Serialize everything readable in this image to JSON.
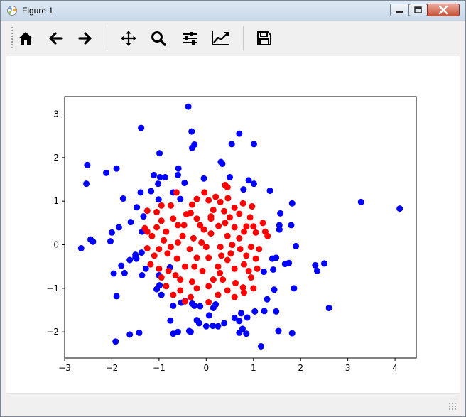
{
  "window": {
    "title": "Figure 1",
    "icons": {
      "app": "matplotlib-app-icon",
      "minimize": "minimize-icon",
      "maximize": "maximize-icon",
      "close": "close-icon"
    }
  },
  "toolbar": {
    "buttons": [
      {
        "name": "home",
        "icon": "home-icon"
      },
      {
        "name": "back",
        "icon": "arrow-left-icon"
      },
      {
        "name": "forward",
        "icon": "arrow-right-icon"
      },
      {
        "name": "pan",
        "icon": "move-icon"
      },
      {
        "name": "zoom",
        "icon": "zoom-icon"
      },
      {
        "name": "subplots",
        "icon": "sliders-icon"
      },
      {
        "name": "edit-axes",
        "icon": "line-chart-icon"
      },
      {
        "name": "save",
        "icon": "save-icon"
      }
    ]
  },
  "colors": {
    "class_outer": "#0000ff",
    "class_inner": "#ff0000"
  },
  "chart_data": {
    "type": "scatter",
    "title": "",
    "xlabel": "",
    "ylabel": "",
    "xlim": [
      -3,
      4.45
    ],
    "ylim": [
      -2.6,
      3.4
    ],
    "x_ticks": [
      -3,
      -2,
      -1,
      0,
      1,
      2,
      3,
      4
    ],
    "y_ticks": [
      -2,
      -1,
      0,
      1,
      2,
      3
    ],
    "x_tick_labels": [
      "−3",
      "−2",
      "−1",
      "0",
      "1",
      "2",
      "3",
      "4"
    ],
    "y_tick_labels": [
      "−2",
      "−1",
      "0",
      "1",
      "2",
      "3"
    ],
    "grid": false,
    "legend": "none",
    "series": [
      {
        "color": "#0000ff",
        "points": [
          [
            -0.38,
            3.17
          ],
          [
            -0.31,
            2.6
          ],
          [
            0.7,
            2.55
          ],
          [
            -1.38,
            2.68
          ],
          [
            -0.3,
            2.22
          ],
          [
            -0.25,
            2.3
          ],
          [
            0.54,
            2.31
          ],
          [
            1.01,
            2.31
          ],
          [
            -0.99,
            2.1
          ],
          [
            0.34,
            1.86
          ],
          [
            0.31,
            1.9
          ],
          [
            -2.52,
            1.83
          ],
          [
            -1.9,
            1.75
          ],
          [
            -2.12,
            1.65
          ],
          [
            -1.11,
            1.6
          ],
          [
            -0.98,
            1.55
          ],
          [
            -0.87,
            1.55
          ],
          [
            -0.59,
            1.75
          ],
          [
            -0.6,
            1.6
          ],
          [
            0.5,
            1.55
          ],
          [
            1.01,
            1.4
          ],
          [
            0.9,
            1.48
          ],
          [
            -0.05,
            1.52
          ],
          [
            -2.54,
            1.4
          ],
          [
            -1.02,
            1.4
          ],
          [
            -0.46,
            1.42
          ],
          [
            0.79,
            1.27
          ],
          [
            1.35,
            1.24
          ],
          [
            -1.17,
            1.23
          ],
          [
            -1.39,
            1.2
          ],
          [
            -0.7,
            1.2
          ],
          [
            -1.76,
            1.06
          ],
          [
            -1.01,
            1.04
          ],
          [
            -0.55,
            1.05
          ],
          [
            1.82,
            0.95
          ],
          [
            1.57,
            0.72
          ],
          [
            -1.47,
            0.86
          ],
          [
            -1.33,
            0.65
          ],
          [
            -1.6,
            0.52
          ],
          [
            -1.85,
            0.4
          ],
          [
            1.55,
            0.45
          ],
          [
            1.8,
            0.45
          ],
          [
            1.55,
            0.35
          ],
          [
            -2.0,
            0.28
          ],
          [
            -2.45,
            0.12
          ],
          [
            -2.4,
            0.07
          ],
          [
            -2.03,
            0.08
          ],
          [
            -1.36,
            0.3
          ],
          [
            -1.37,
            -0.18
          ],
          [
            1.9,
            -0.03
          ],
          [
            -1.5,
            -0.29
          ],
          [
            -1.48,
            -0.32
          ],
          [
            -1.5,
            -0.23
          ],
          [
            -2.65,
            -0.08
          ],
          [
            -1.62,
            -0.35
          ],
          [
            1.4,
            -0.32
          ],
          [
            1.48,
            -0.3
          ],
          [
            -1.8,
            -0.48
          ],
          [
            -1.28,
            -0.55
          ],
          [
            1.67,
            -0.44
          ],
          [
            1.75,
            -0.42
          ],
          [
            2.31,
            -0.47
          ],
          [
            2.5,
            -0.43
          ],
          [
            -1.73,
            -0.65
          ],
          [
            -1.96,
            -0.66
          ],
          [
            2.35,
            -0.6
          ],
          [
            -1.36,
            -0.7
          ],
          [
            1.42,
            -0.57
          ],
          [
            -1.0,
            -0.7
          ],
          [
            -0.77,
            -0.52
          ],
          [
            1.22,
            -0.62
          ],
          [
            -0.99,
            -0.93
          ],
          [
            -1.05,
            -1.02
          ],
          [
            -0.95,
            -1.15
          ],
          [
            -0.53,
            -1.33
          ],
          [
            -1.9,
            -1.18
          ],
          [
            -0.45,
            -1.29
          ],
          [
            -0.3,
            -1.35
          ],
          [
            0.2,
            -1.37
          ],
          [
            1.29,
            -1.25
          ],
          [
            1.86,
            -1.0
          ],
          [
            1.44,
            -1.03
          ],
          [
            -0.7,
            -1.4
          ],
          [
            -0.25,
            -1.4
          ],
          [
            -0.13,
            -1.41
          ],
          [
            2.6,
            -1.45
          ],
          [
            0.15,
            -1.45
          ],
          [
            0.74,
            -1.57
          ],
          [
            0.6,
            -1.68
          ],
          [
            0.06,
            -1.62
          ],
          [
            -0.76,
            -1.74
          ],
          [
            -0.2,
            -1.73
          ],
          [
            -0.15,
            -1.8
          ],
          [
            0.38,
            -1.8
          ],
          [
            0.7,
            -1.75
          ],
          [
            1.03,
            -1.53
          ],
          [
            1.23,
            -1.52
          ],
          [
            1.48,
            -1.53
          ],
          [
            0.87,
            -1.67
          ],
          [
            0.77,
            -1.93
          ],
          [
            0.0,
            -1.87
          ],
          [
            0.14,
            -1.86
          ],
          [
            -0.6,
            -2.0
          ],
          [
            -0.7,
            -2.04
          ],
          [
            -0.33,
            -2.0
          ],
          [
            -1.42,
            -2.02
          ],
          [
            -1.62,
            -2.06
          ],
          [
            -0.36,
            -1.98
          ],
          [
            0.25,
            -1.87
          ],
          [
            0.7,
            -2.02
          ],
          [
            0.85,
            -2.04
          ],
          [
            1.53,
            -1.98
          ],
          [
            1.82,
            -2.03
          ],
          [
            -1.92,
            -2.22
          ],
          [
            1.16,
            -2.33
          ],
          [
            3.28,
            0.98
          ],
          [
            4.1,
            0.83
          ]
        ]
      },
      {
        "color": "#ff0000",
        "points": [
          [
            0.4,
            1.37
          ],
          [
            0.45,
            1.32
          ],
          [
            -0.63,
            1.2
          ],
          [
            -0.04,
            1.2
          ],
          [
            -0.2,
            1.05
          ],
          [
            0.05,
            1.02
          ],
          [
            -0.95,
            0.9
          ],
          [
            -0.75,
            0.9
          ],
          [
            -0.3,
            0.92
          ],
          [
            0.3,
            0.98
          ],
          [
            0.46,
            1.07
          ],
          [
            0.78,
            0.95
          ],
          [
            0.97,
            0.88
          ],
          [
            -1.25,
            0.78
          ],
          [
            -1.05,
            0.75
          ],
          [
            -0.33,
            0.73
          ],
          [
            0.15,
            0.8
          ],
          [
            0.38,
            0.77
          ],
          [
            0.7,
            0.71
          ],
          [
            1.2,
            0.5
          ],
          [
            -0.95,
            0.55
          ],
          [
            -0.7,
            0.6
          ],
          [
            -0.2,
            0.6
          ],
          [
            0.1,
            0.65
          ],
          [
            0.5,
            0.63
          ],
          [
            0.93,
            0.63
          ],
          [
            -1.25,
            0.3
          ],
          [
            -1.05,
            0.4
          ],
          [
            -0.85,
            0.3
          ],
          [
            -0.6,
            0.45
          ],
          [
            -0.47,
            0.45
          ],
          [
            -0.13,
            0.45
          ],
          [
            0.26,
            0.43
          ],
          [
            0.6,
            0.4
          ],
          [
            0.85,
            0.42
          ],
          [
            1.0,
            0.42
          ],
          [
            -1.3,
            0.38
          ],
          [
            -1.15,
            0.2
          ],
          [
            -0.9,
            0.1
          ],
          [
            -0.5,
            0.2
          ],
          [
            -0.27,
            0.15
          ],
          [
            0.1,
            0.26
          ],
          [
            0.45,
            0.2
          ],
          [
            0.8,
            0.3
          ],
          [
            1.05,
            0.28
          ],
          [
            1.25,
            0.3
          ],
          [
            1.3,
            0.2
          ],
          [
            -1.0,
            -0.1
          ],
          [
            -0.75,
            -0.05
          ],
          [
            -0.35,
            -0.1
          ],
          [
            0.0,
            -0.05
          ],
          [
            0.3,
            -0.05
          ],
          [
            0.55,
            0.0
          ],
          [
            0.72,
            -0.1
          ],
          [
            0.95,
            -0.05
          ],
          [
            1.12,
            -0.1
          ],
          [
            -1.25,
            -0.08
          ],
          [
            -1.1,
            -0.25
          ],
          [
            -0.82,
            -0.2
          ],
          [
            -0.62,
            -0.32
          ],
          [
            -0.2,
            -0.3
          ],
          [
            0.05,
            -0.3
          ],
          [
            0.32,
            -0.25
          ],
          [
            0.52,
            -0.2
          ],
          [
            0.85,
            -0.25
          ],
          [
            1.05,
            -0.32
          ],
          [
            -1.18,
            -0.45
          ],
          [
            -1.0,
            -0.55
          ],
          [
            -0.8,
            -0.6
          ],
          [
            -0.45,
            -0.5
          ],
          [
            -0.08,
            -0.6
          ],
          [
            0.25,
            -0.5
          ],
          [
            0.6,
            -0.55
          ],
          [
            0.9,
            -0.6
          ],
          [
            1.08,
            -0.55
          ],
          [
            -0.95,
            -0.75
          ],
          [
            -0.65,
            -0.7
          ],
          [
            -0.3,
            -0.85
          ],
          [
            0.15,
            -0.8
          ],
          [
            0.35,
            -0.8
          ],
          [
            0.62,
            -0.88
          ],
          [
            0.95,
            -0.75
          ],
          [
            -0.85,
            -0.95
          ],
          [
            -0.55,
            -1.05
          ],
          [
            -0.2,
            -1.0
          ],
          [
            0.05,
            -0.95
          ],
          [
            0.45,
            -1.05
          ],
          [
            0.78,
            -0.98
          ],
          [
            1.0,
            -1.0
          ],
          [
            -0.7,
            -1.15
          ],
          [
            -0.33,
            -1.2
          ],
          [
            0.25,
            -1.15
          ],
          [
            0.6,
            -1.2
          ],
          [
            0.8,
            -1.1
          ],
          [
            -0.45,
            -1.3
          ],
          [
            0.05,
            -1.32
          ],
          [
            0.29,
            -0.65
          ],
          [
            -0.1,
            0.05
          ],
          [
            0.4,
            0.5
          ],
          [
            -0.42,
            0.7
          ],
          [
            0.6,
            0.85
          ],
          [
            0.2,
            1.1
          ],
          [
            -0.6,
            0.05
          ],
          [
            0.7,
            0.15
          ],
          [
            -0.25,
            -0.5
          ],
          [
            0.45,
            -0.35
          ],
          [
            -0.05,
            0.35
          ],
          [
            0.8,
            -0.45
          ],
          [
            -0.55,
            -0.8
          ],
          [
            0.1,
            0.6
          ]
        ]
      }
    ]
  }
}
